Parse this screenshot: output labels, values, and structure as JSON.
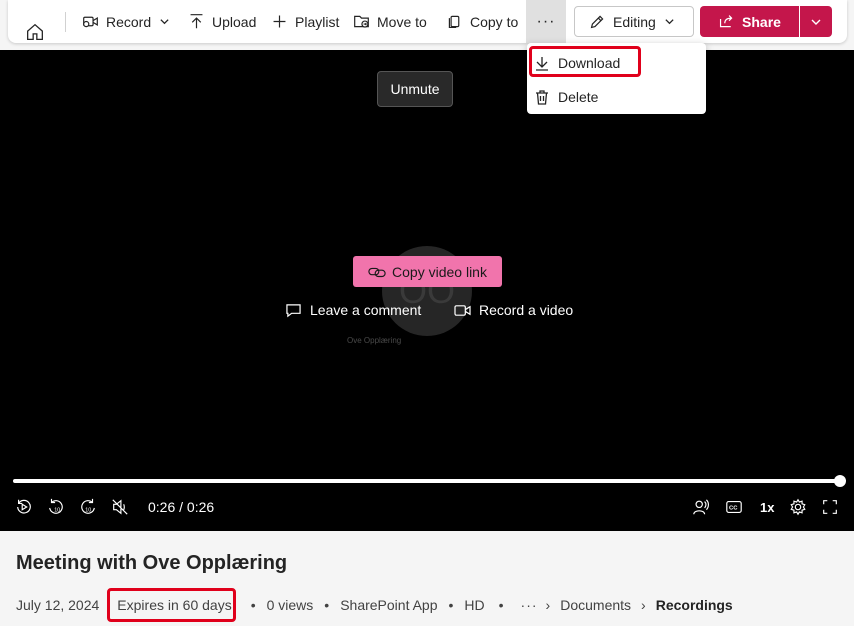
{
  "toolbar": {
    "record_label": "Record",
    "upload_label": "Upload",
    "playlist_label": "Playlist",
    "move_label": "Move to",
    "copy_label": "Copy to",
    "more_label": "···",
    "editing_label": "Editing",
    "share_label": "Share",
    "icons": [
      "home-icon",
      "record-icon",
      "upload-icon",
      "add-icon",
      "move-icon",
      "copy-icon",
      "more-icon",
      "pencil-icon",
      "share-icon",
      "chevron-down-icon"
    ]
  },
  "more_menu": {
    "items": [
      {
        "label": "Download",
        "icon": "download-icon"
      },
      {
        "label": "Delete",
        "icon": "trash-icon"
      }
    ]
  },
  "player": {
    "tooltip": "Unmute",
    "copy_link_label": "Copy video link",
    "leave_comment_label": "Leave a comment",
    "record_video_label": "Record a video",
    "avatar_initials": "OO",
    "avatar_name": "Ove Opplæring",
    "time": "0:26 / 0:26",
    "progress": 1.0,
    "speed": "1x",
    "cc": "CC"
  },
  "video_info": {
    "title": "Meeting with Ove Opplæring",
    "date": "July 12, 2024",
    "expires": "Expires in 60 days",
    "views": "0 views",
    "app": "SharePoint App",
    "quality": "HD",
    "more": "···",
    "breadcrumb": [
      "Documents",
      "Recordings"
    ]
  },
  "colors": {
    "accent": "#c4164b",
    "copy_link_bg": "#f174ac",
    "highlight": "#e0001b",
    "video_bg": "#000000"
  }
}
